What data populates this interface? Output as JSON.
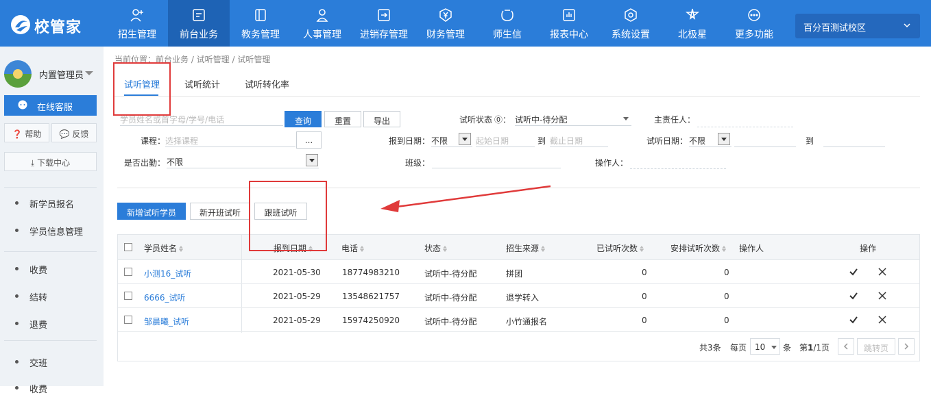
{
  "brand": {
    "name": "校管家"
  },
  "nav": {
    "items": [
      {
        "label": "招生管理",
        "icon": "user-plus-icon"
      },
      {
        "label": "前台业务",
        "icon": "desk-icon"
      },
      {
        "label": "教务管理",
        "icon": "book-icon"
      },
      {
        "label": "人事管理",
        "icon": "person-icon"
      },
      {
        "label": "进销存管理",
        "icon": "inventory-icon"
      },
      {
        "label": "财务管理",
        "icon": "yuan-icon"
      },
      {
        "label": "师生信",
        "icon": "message-icon"
      },
      {
        "label": "报表中心",
        "icon": "report-icon"
      },
      {
        "label": "系统设置",
        "icon": "settings-icon"
      },
      {
        "label": "北极星",
        "icon": "star-icon"
      },
      {
        "label": "更多功能",
        "icon": "more-icon"
      }
    ],
    "active_index": 1,
    "campus": "百分百测试校区"
  },
  "sidebar": {
    "user": "内置管理员",
    "service": "在线客服",
    "help": "帮助",
    "feedback": "反馈",
    "download": "下载中心",
    "groups": [
      [
        "新学员报名",
        "学员信息管理"
      ],
      [
        "收费",
        "结转",
        "退费"
      ],
      [
        "交班",
        "收费"
      ]
    ]
  },
  "breadcrumb": "当前位置：前台业务 / 试听管理 / 试听管理",
  "tabs": [
    "试听管理",
    "试听统计",
    "试听转化率"
  ],
  "filters": {
    "search_placeholder": "学员姓名或首字母/学号/电话",
    "query_button": "查询",
    "reset_button": "重置",
    "export_button": "导出",
    "status_label": "试听状态",
    "status_value": "试听中-待分配",
    "owner_label": "主责任人：",
    "course_label": "课程：",
    "course_placeholder": "选择课程",
    "course_more": "...",
    "report_date_label": "报到日期：",
    "report_date_value": "不限",
    "start_date_placeholder": "起始日期",
    "to": "到",
    "end_date_placeholder": "截止日期",
    "trial_date_label": "试听日期：",
    "trial_date_value": "不限",
    "attendance_label": "是否出勤：",
    "attendance_value": "不限",
    "class_label": "班级：",
    "operator_label": "操作人："
  },
  "actions": {
    "add_trial": "新增试听学员",
    "new_class_trial": "新开班试听",
    "follow_class_trial": "跟班试听"
  },
  "table": {
    "columns": [
      "学员姓名",
      "报到日期",
      "电话",
      "状态",
      "招生来源",
      "已试听次数",
      "安排试听次数",
      "操作人",
      "操作"
    ],
    "rows": [
      {
        "name": "小测16_试听",
        "date": "2021-05-30",
        "phone": "18774983210",
        "status": "试听中-待分配",
        "source": "拼团",
        "attended": "0",
        "scheduled": "0",
        "operator": ""
      },
      {
        "name": "6666_试听",
        "date": "2021-05-29",
        "phone": "13548621757",
        "status": "试听中-待分配",
        "source": "退学转入",
        "attended": "0",
        "scheduled": "0",
        "operator": ""
      },
      {
        "name": "邹晨曦_试听",
        "date": "2021-05-29",
        "phone": "15974250920",
        "status": "试听中-待分配",
        "source": "小竹通报名",
        "attended": "0",
        "scheduled": "0",
        "operator": ""
      }
    ]
  },
  "pagination": {
    "total": "共3条",
    "per_page_label": "每页",
    "per_page": "10",
    "unit": "条",
    "page_prefix": "第",
    "page_current": "1",
    "page_suffix": "/1页",
    "jump": "跳转页"
  },
  "colors": {
    "primary": "#2b7dd9",
    "annotation": "#e03a3a"
  }
}
